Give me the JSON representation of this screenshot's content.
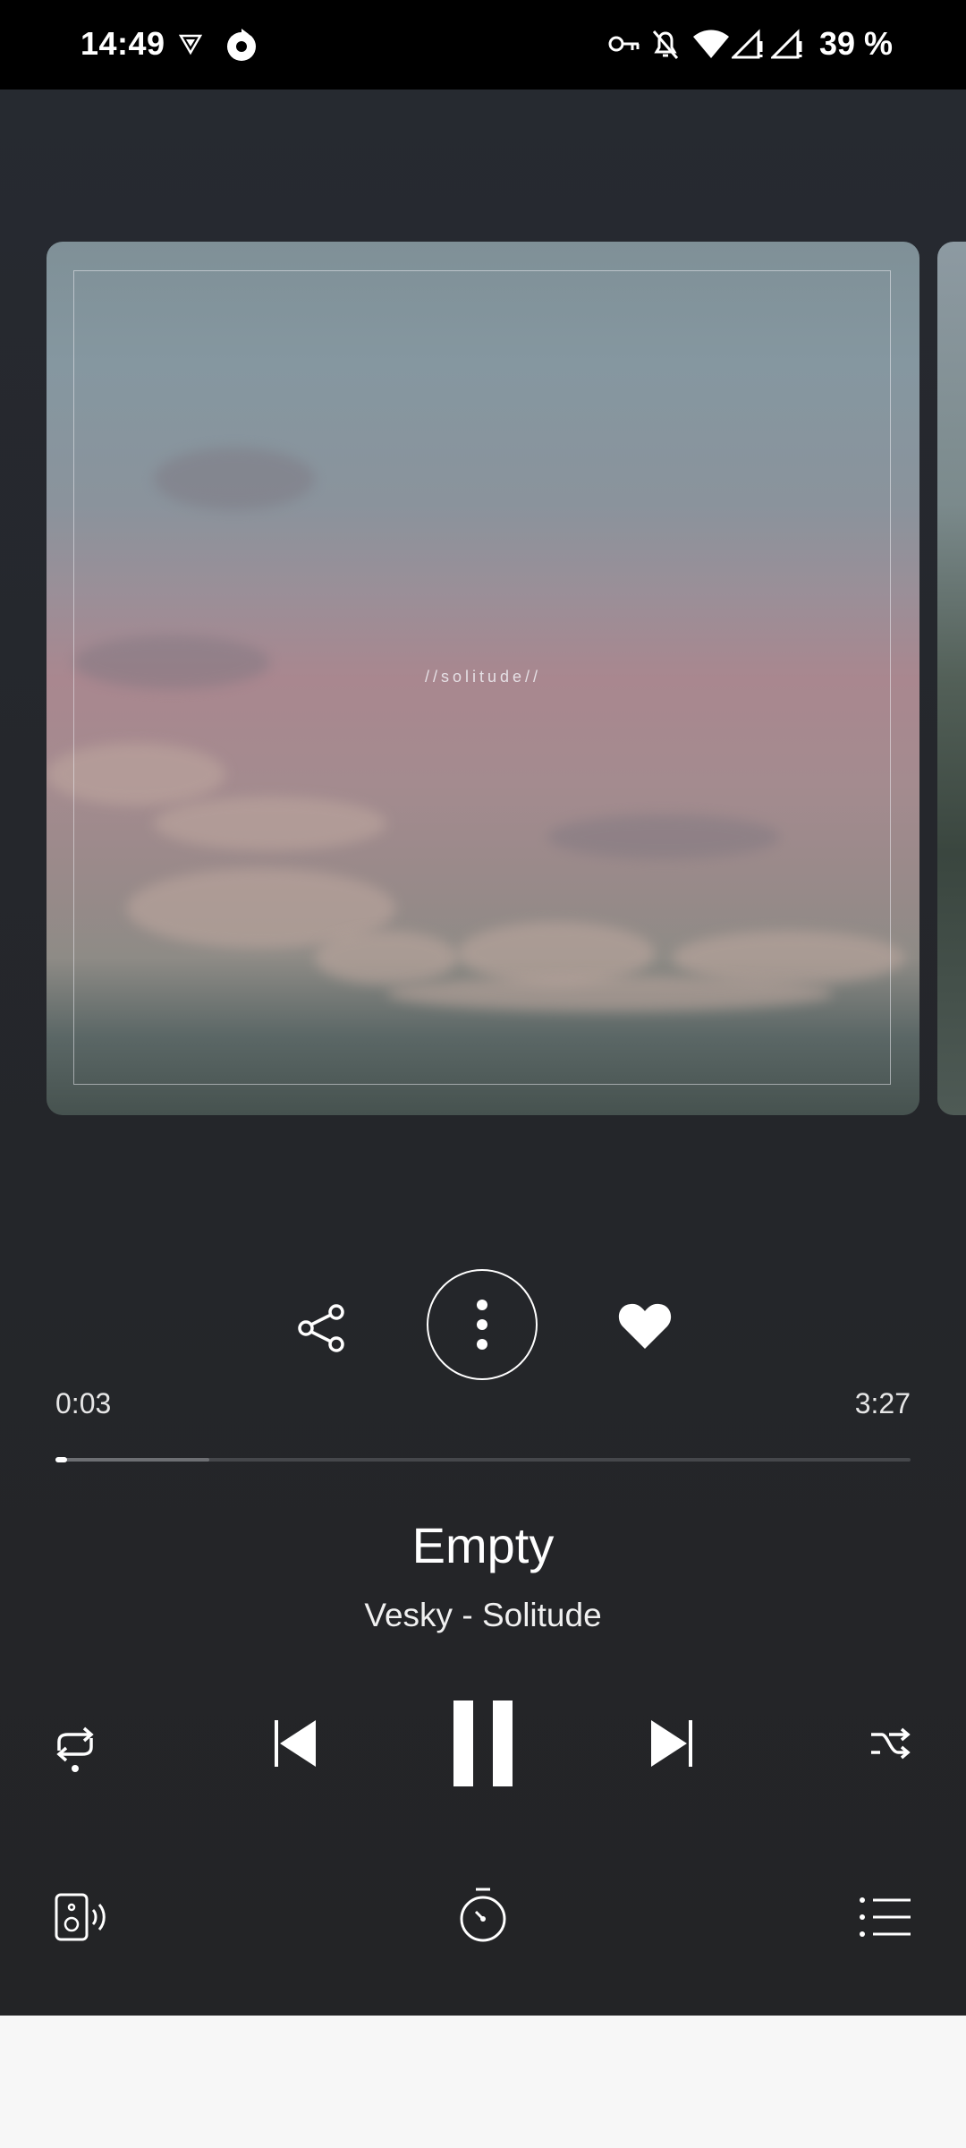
{
  "status_bar": {
    "time": "14:49",
    "battery": "39 %",
    "left_icons": [
      "vpn-shield-icon",
      "refresh-circle-icon"
    ],
    "right_icons": [
      "key-icon",
      "notifications-off-icon",
      "wifi-icon",
      "signal-icon",
      "signal-icon"
    ]
  },
  "album": {
    "art_text": "//solitude//"
  },
  "actions": {
    "share_icon": "share-icon",
    "more_icon": "more-vertical-icon",
    "favorite_icon": "heart-icon"
  },
  "progress": {
    "current": "0:03",
    "total": "3:27",
    "played_fraction": 0.014,
    "buffered_fraction": 0.18
  },
  "track": {
    "title": "Empty",
    "subtitle": "Vesky - Solitude"
  },
  "controls": [
    "repeat-icon",
    "skip-previous-icon",
    "pause-icon",
    "skip-next-icon",
    "shuffle-icon"
  ],
  "bottom_bar": [
    "cast-speaker-icon",
    "sleep-timer-icon",
    "queue-icon"
  ],
  "colors": {
    "background": "#25272c",
    "status_bar": "#000000",
    "accent": "#ffffff",
    "track_inactive": "#45474b"
  }
}
